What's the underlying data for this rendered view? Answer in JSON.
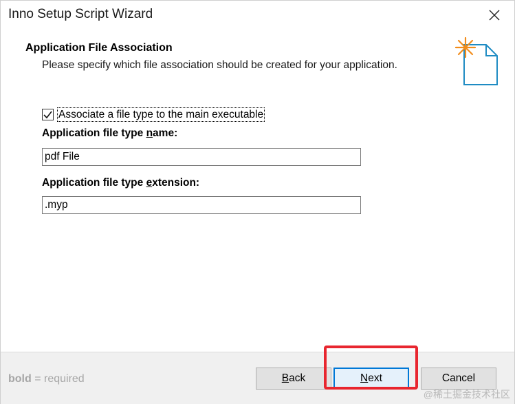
{
  "window": {
    "title": "Inno Setup Script Wizard"
  },
  "header": {
    "title": "Application File Association",
    "subtitle": "Please specify which file association should be created for your application."
  },
  "form": {
    "associate_checkbox": {
      "label": "Associate a file type to the main executable",
      "checked": true
    },
    "type_name": {
      "label_before": "Application file type ",
      "label_accel": "n",
      "label_after": "ame:",
      "value": "pdf File"
    },
    "type_extension": {
      "label_before": "Application file type ",
      "label_accel": "e",
      "label_after": "xtension:",
      "value": ".myp"
    }
  },
  "footer": {
    "hint_bold": "bold",
    "hint_rest": " = required",
    "back_accel": "B",
    "back_rest": "ack",
    "next_accel": "N",
    "next_rest": "ext",
    "cancel_label": "Cancel"
  },
  "watermark": "@稀土掘金技术社区",
  "colors": {
    "highlight": "#e8262f",
    "accent": "#0078d7",
    "icon_star": "#f28c1a",
    "icon_doc": "#1e8bc3"
  }
}
